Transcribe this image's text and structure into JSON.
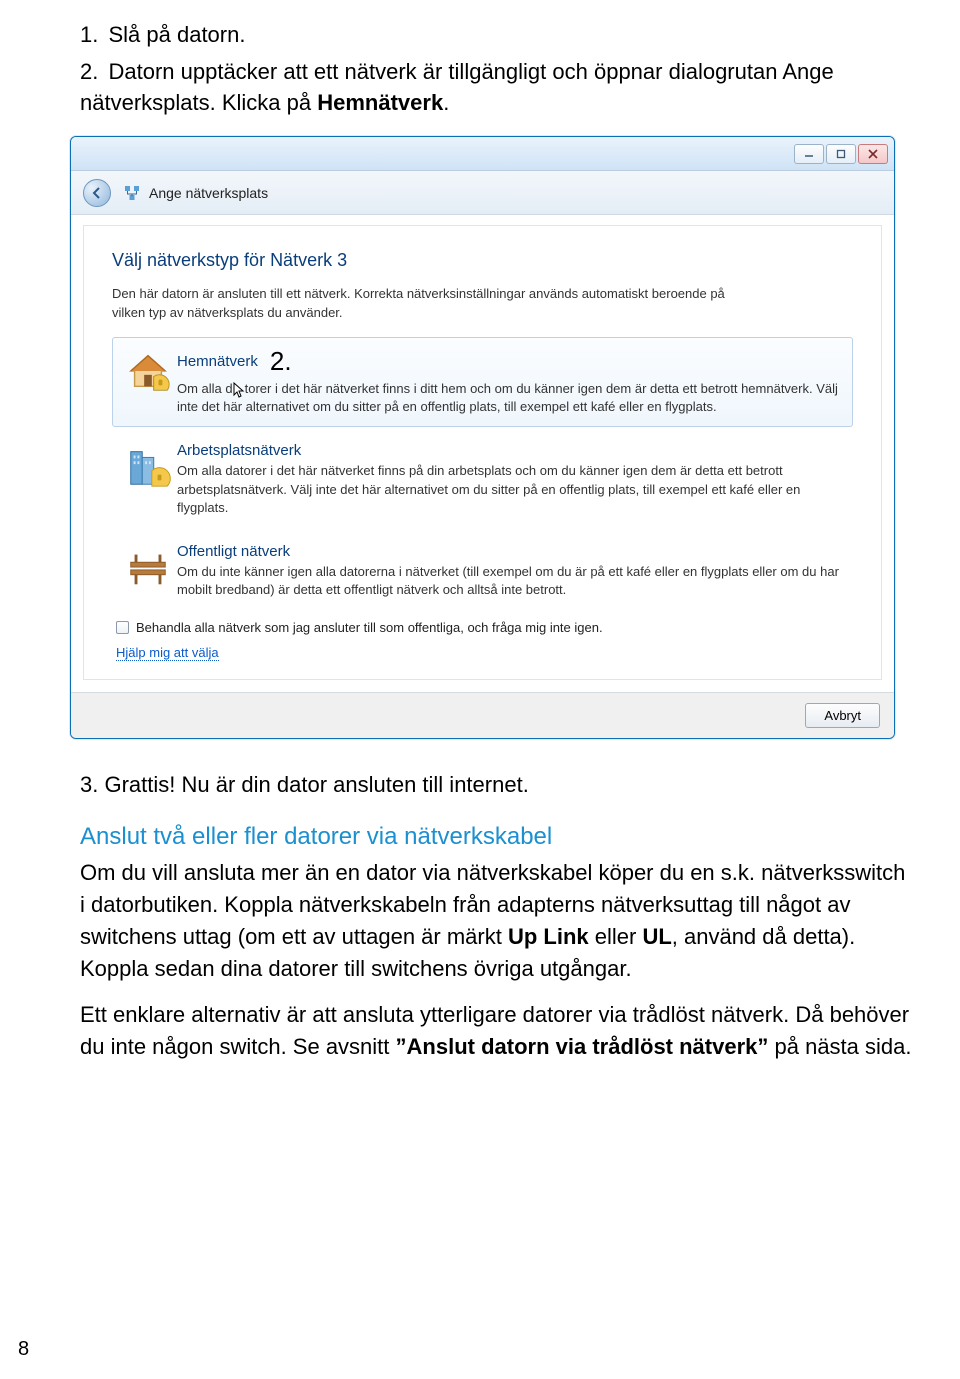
{
  "intro": {
    "step1_num": "1.",
    "step1_text": "Slå på datorn.",
    "step2_num": "2.",
    "step2_text_a": "Datorn upptäcker att ett nätverk är tillgängligt och öppnar dialogrutan Ange nätverksplats. Klicka på ",
    "step2_bold": "Hemnätverk",
    "step2_text_b": "."
  },
  "dialog": {
    "header_title": "Ange nätverksplats",
    "heading": "Välj nätverkstyp för Nätverk  3",
    "desc": "Den här datorn är ansluten till ett nätverk. Korrekta nätverksinställningar används automatiskt beroende på vilken typ av nätverksplats du använder.",
    "annotation": "2.",
    "options": [
      {
        "title": "Hemnätverk",
        "text": "Om alla datorer i det här nätverket finns i ditt hem och om du känner igen dem är detta ett betrott hemnätverk. Välj inte det här alternativet om du sitter på en offentlig plats, till exempel ett kafé eller en flygplats."
      },
      {
        "title": "Arbetsplatsnätverk",
        "text": "Om alla datorer i det här nätverket finns på din arbetsplats och om du känner igen dem är detta ett betrott arbetsplatsnätverk. Välj inte det här alternativet om du sitter på en offentlig plats, till exempel ett kafé eller en flygplats."
      },
      {
        "title": "Offentligt nätverk",
        "text": "Om du inte känner igen alla datorerna i nätverket (till exempel om du är på ett kafé eller en flygplats eller om du har mobilt bredband) är detta ett offentligt nätverk och alltså inte betrott."
      }
    ],
    "checkbox_label": "Behandla alla nätverk som jag ansluter till som offentliga, och fråga mig inte igen.",
    "help_link": "Hjälp mig att välja",
    "cancel_label": "Avbryt"
  },
  "step3_num": "3.",
  "step3_text": "Grattis! Nu är din dator ansluten till internet.",
  "section_heading": "Anslut två eller ﬂer datorer via nätverkskabel",
  "para1_a": "Om du vill ansluta mer än en dator via nätverkskabel köper du en s.k. nätverksswitch i datorbutiken. Koppla nätverkskabeln från adapterns nätverksuttag till något av switchens uttag (om ett av uttagen är märkt ",
  "para1_bold1": "Up Link",
  "para1_b": " eller ",
  "para1_bold2": "UL",
  "para1_c": ", använd då detta). Koppla sedan dina datorer till switchens övriga utgångar.",
  "para2_a": "Ett enklare alternativ är att ansluta ytterligare datorer via trådlöst nätverk. Då behöver du inte någon switch. Se avsnitt ",
  "para2_bold": "”Anslut datorn via trådlöst nätverk”",
  "para2_b": " på nästa sida.",
  "page_number": "8"
}
